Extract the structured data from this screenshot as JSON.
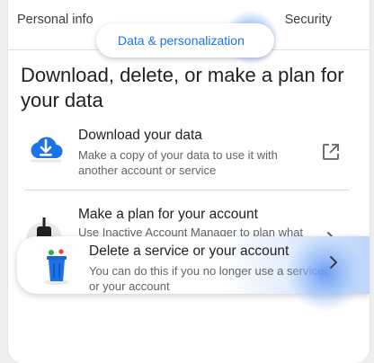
{
  "tabs": {
    "left_label": "Personal info",
    "active_label": "Data & personalization",
    "right_label": "Security"
  },
  "card": {
    "title": "Download, delete, or make a plan for your data",
    "items": [
      {
        "title": "Download your data",
        "description": "Make a copy of your data to use it with another account or service",
        "icon": "cloud-download-icon",
        "trailing_icon": "open-external-icon"
      },
      {
        "title": "Make a plan for your account",
        "description": "Use Inactive Account Manager to plan what happens to your data if you stop using your account",
        "icon": "power-plug-icon",
        "trailing_icon": "chevron-right-icon"
      },
      {
        "title": "Delete a service or your account",
        "description": "You can do this if you no longer use a service or your account",
        "icon": "trash-can-icon",
        "trailing_icon": "chevron-right-icon"
      }
    ]
  },
  "colors": {
    "accent": "#1a73e8",
    "highlight": "#d2e3fc",
    "text_primary": "#202124",
    "text_secondary": "#5f6368"
  }
}
